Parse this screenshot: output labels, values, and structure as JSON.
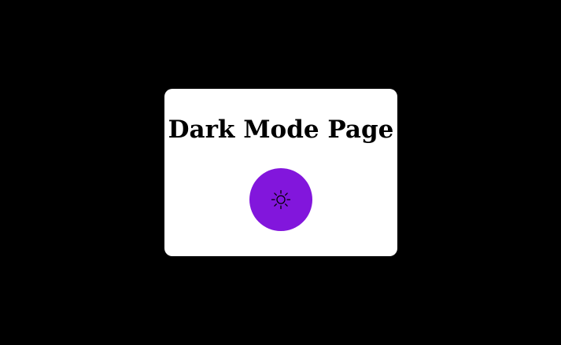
{
  "page": {
    "title": "Dark Mode Page"
  },
  "toggle": {
    "icon": "sun-icon",
    "color": "#8216dc"
  },
  "colors": {
    "background": "#000000",
    "card": "#ffffff",
    "accent": "#8216dc"
  }
}
